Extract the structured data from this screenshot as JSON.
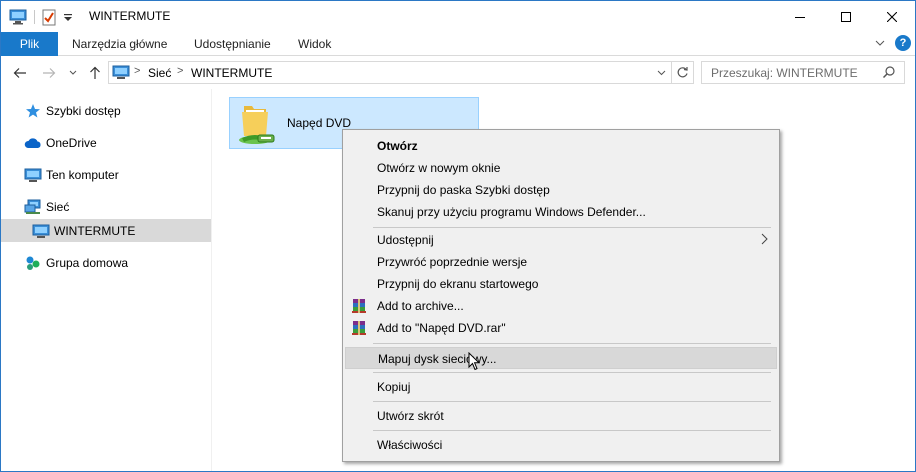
{
  "window": {
    "title": "WINTERMUTE"
  },
  "ribbon": {
    "file_tab": "Plik",
    "tabs": [
      "Narzędzia główne",
      "Udostępnianie",
      "Widok"
    ],
    "help": "?"
  },
  "navigation": {
    "breadcrumbs": [
      "Sieć",
      "WINTERMUTE"
    ],
    "search_placeholder": "Przeszukaj: WINTERMUTE"
  },
  "sidebar": {
    "items": [
      {
        "label": "Szybki dostęp",
        "icon": "star-icon"
      },
      {
        "label": "OneDrive",
        "icon": "cloud-icon"
      },
      {
        "label": "Ten komputer",
        "icon": "computer-icon"
      },
      {
        "label": "Sieć",
        "icon": "network-icon"
      },
      {
        "label": "WINTERMUTE",
        "icon": "computer-icon",
        "selected": true
      },
      {
        "label": "Grupa domowa",
        "icon": "homegroup-icon"
      }
    ]
  },
  "content": {
    "items": [
      {
        "label": "Napęd DVD",
        "icon": "shared-folder-icon",
        "selected": true
      }
    ]
  },
  "context_menu": {
    "groups": [
      [
        "Otwórz",
        "Otwórz w nowym oknie",
        "Przypnij do paska Szybki dostęp",
        "Skanuj przy użyciu programu Windows Defender..."
      ],
      [
        "Udostępnij",
        "Przywróć poprzednie wersje",
        "Przypnij do ekranu startowego",
        "Add to archive...",
        "Add to \"Napęd DVD.rar\""
      ],
      [
        "Mapuj dysk sieciowy..."
      ],
      [
        "Kopiuj"
      ],
      [
        "Utwórz skrót"
      ],
      [
        "Właściwości"
      ]
    ],
    "default_item": "Otwórz",
    "submenu_item": "Udostępnij",
    "hovered_item": "Mapuj dysk sieciowy...",
    "archive_icon": "winrar-icon"
  },
  "colors": {
    "accent": "#1979ca",
    "selection": "#cce8ff",
    "menu_bg": "#f0f0f0"
  }
}
